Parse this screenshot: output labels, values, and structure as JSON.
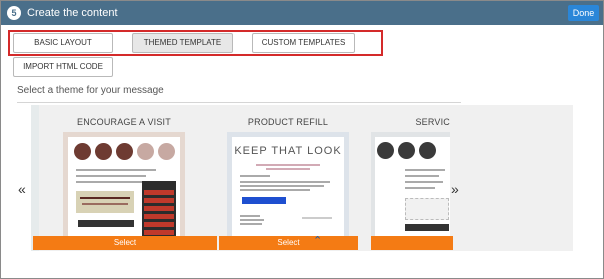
{
  "header": {
    "step": "5",
    "title": "Create the content",
    "done_label": "Done"
  },
  "tabs": [
    {
      "label": "BASIC LAYOUT"
    },
    {
      "label": "THEMED TEMPLATE"
    },
    {
      "label": "CUSTOM TEMPLATES"
    },
    {
      "label": "IMPORT HTML CODE"
    }
  ],
  "theme_prompt": "Select a theme for your message",
  "carousel": {
    "prev_glyph": "«",
    "next_glyph": "»",
    "scroll_glyph": "⌃",
    "cards": [
      {
        "title": "ENCOURAGE A VISIT",
        "select_label": "Select"
      },
      {
        "title": "PRODUCT REFILL",
        "select_label": "Select",
        "preview_headline": "KEEP THAT LOOK"
      },
      {
        "title": "SERVIC",
        "select_label": ""
      }
    ]
  },
  "colors": {
    "header": "#4a6f8a",
    "done": "#2a86d8",
    "select": "#f47b14",
    "highlight": "#d42a2a"
  }
}
